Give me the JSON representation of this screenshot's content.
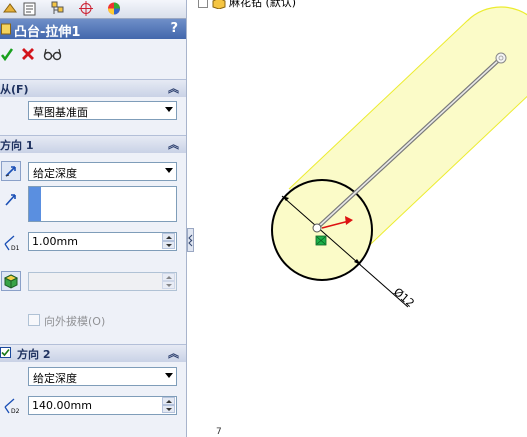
{
  "panel": {
    "tabs": [
      {
        "name": "feature-manager-tab-icon"
      },
      {
        "name": "property-manager-tab-icon"
      },
      {
        "name": "configuration-manager-tab-icon"
      },
      {
        "name": "dimxpert-manager-tab-icon"
      },
      {
        "name": "display-manager-tab-icon"
      }
    ],
    "title": "凸台-拉伸1",
    "help_label": "?",
    "actions": {
      "ok_icon": "checkmark-icon",
      "cancel_icon": "cross-icon",
      "preview_icon": "glasses-icon"
    }
  },
  "from": {
    "header": "从(F)",
    "selected": "草图基准面"
  },
  "direction1": {
    "header": "方向 1",
    "end_condition": "给定深度",
    "depth": "1.00mm",
    "draft_label": "向外拔模(O)"
  },
  "direction2": {
    "header": "方向 2",
    "checked": true,
    "end_condition": "给定深度",
    "depth": "140.00mm"
  },
  "tree": {
    "item": "麻花钻 (默认)"
  },
  "viewport": {
    "diameter_label": "Ø12",
    "triad_label": "7"
  },
  "colors": {
    "cylinder_fill": "#fbfbc8",
    "cylinder_edge": "#ecec30",
    "title_bar": "#4267ac",
    "selection_bar": "#5a8fe0"
  }
}
